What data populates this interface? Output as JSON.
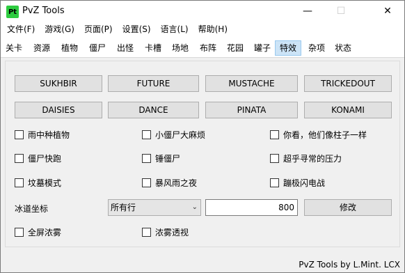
{
  "window": {
    "title": "PvZ Tools",
    "icon_text": "Pt",
    "minimize": "—",
    "maximize": "☐",
    "close": "✕"
  },
  "menu": [
    "文件(F)",
    "游戏(G)",
    "页面(P)",
    "设置(S)",
    "语言(L)",
    "帮助(H)"
  ],
  "tabs": [
    {
      "label": "关卡"
    },
    {
      "label": "资源"
    },
    {
      "label": "植物"
    },
    {
      "label": "僵尸"
    },
    {
      "label": "出怪"
    },
    {
      "label": "卡槽"
    },
    {
      "label": "场地"
    },
    {
      "label": "布阵"
    },
    {
      "label": "花园"
    },
    {
      "label": "罐子"
    },
    {
      "label": "特效",
      "active": true
    },
    {
      "label": "杂项"
    },
    {
      "label": "状态"
    }
  ],
  "codes_row1": [
    "SUKHBIR",
    "FUTURE",
    "MUSTACHE",
    "TRICKEDOUT"
  ],
  "codes_row2": [
    "DAISIES",
    "DANCE",
    "PINATA",
    "KONAMI"
  ],
  "checks": [
    [
      "雨中种植物",
      "小僵尸大麻烦",
      "你看，他们像柱子一样"
    ],
    [
      "僵尸快跑",
      "锤僵尸",
      "超乎寻常的压力"
    ],
    [
      "坟墓模式",
      "暴风雨之夜",
      "蹦极闪电战"
    ]
  ],
  "ice": {
    "label": "冰道坐标",
    "select_value": "所有行",
    "input_value": "800",
    "button": "修改"
  },
  "fog": {
    "fullscreen": "全屏浓雾",
    "see_through": "浓雾透视"
  },
  "status": {
    "credit": "PvZ Tools by L.Mint. LCX"
  }
}
